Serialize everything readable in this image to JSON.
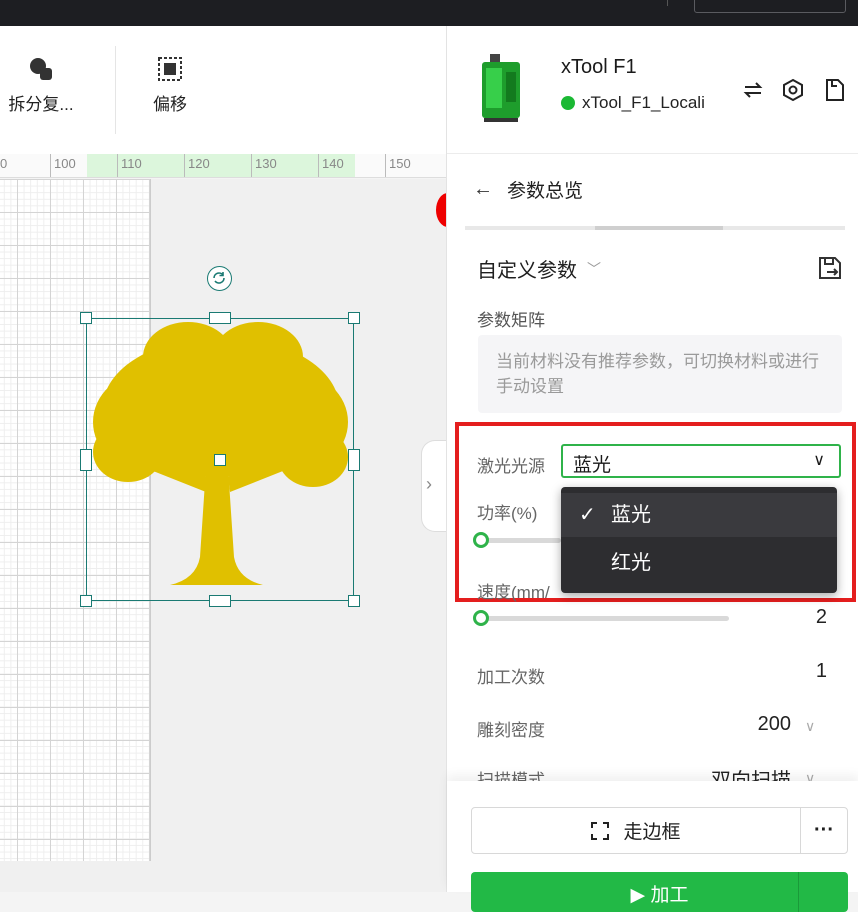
{
  "toolbar": {
    "split_label": "拆分复...",
    "offset_label": "偏移"
  },
  "ruler": {
    "ticks": [
      "0",
      "100",
      "110",
      "120",
      "130",
      "140",
      "150"
    ]
  },
  "device": {
    "name": "xTool F1",
    "connection": "xTool_F1_Locali"
  },
  "panel": {
    "back_title": "参数总览",
    "custom_params": "自定义参数",
    "matrix_label": "参数矩阵",
    "matrix_hint": "当前材料没有推荐参数，可切换材料或进行手动设置",
    "laser_source_label": "激光光源",
    "laser_source_value": "蓝光",
    "power_label": "功率(%)",
    "speed_label": "速度(mm/",
    "speed_value": "2",
    "passes_label": "加工次数",
    "passes_value": "1",
    "density_label": "雕刻密度",
    "density_value": "200",
    "scan_label": "扫描模式",
    "scan_value": "双向扫描"
  },
  "dropdown": {
    "options": [
      {
        "label": "蓝光",
        "selected": true
      },
      {
        "label": "红光",
        "selected": false
      }
    ]
  },
  "footer": {
    "frame_label": "走边框",
    "more_label": "···",
    "process_label": "加工"
  },
  "colors": {
    "accent": "#22b946",
    "tree": "#e0c000",
    "selection": "#1a7a73",
    "highlight_frame": "#e41e1e"
  }
}
